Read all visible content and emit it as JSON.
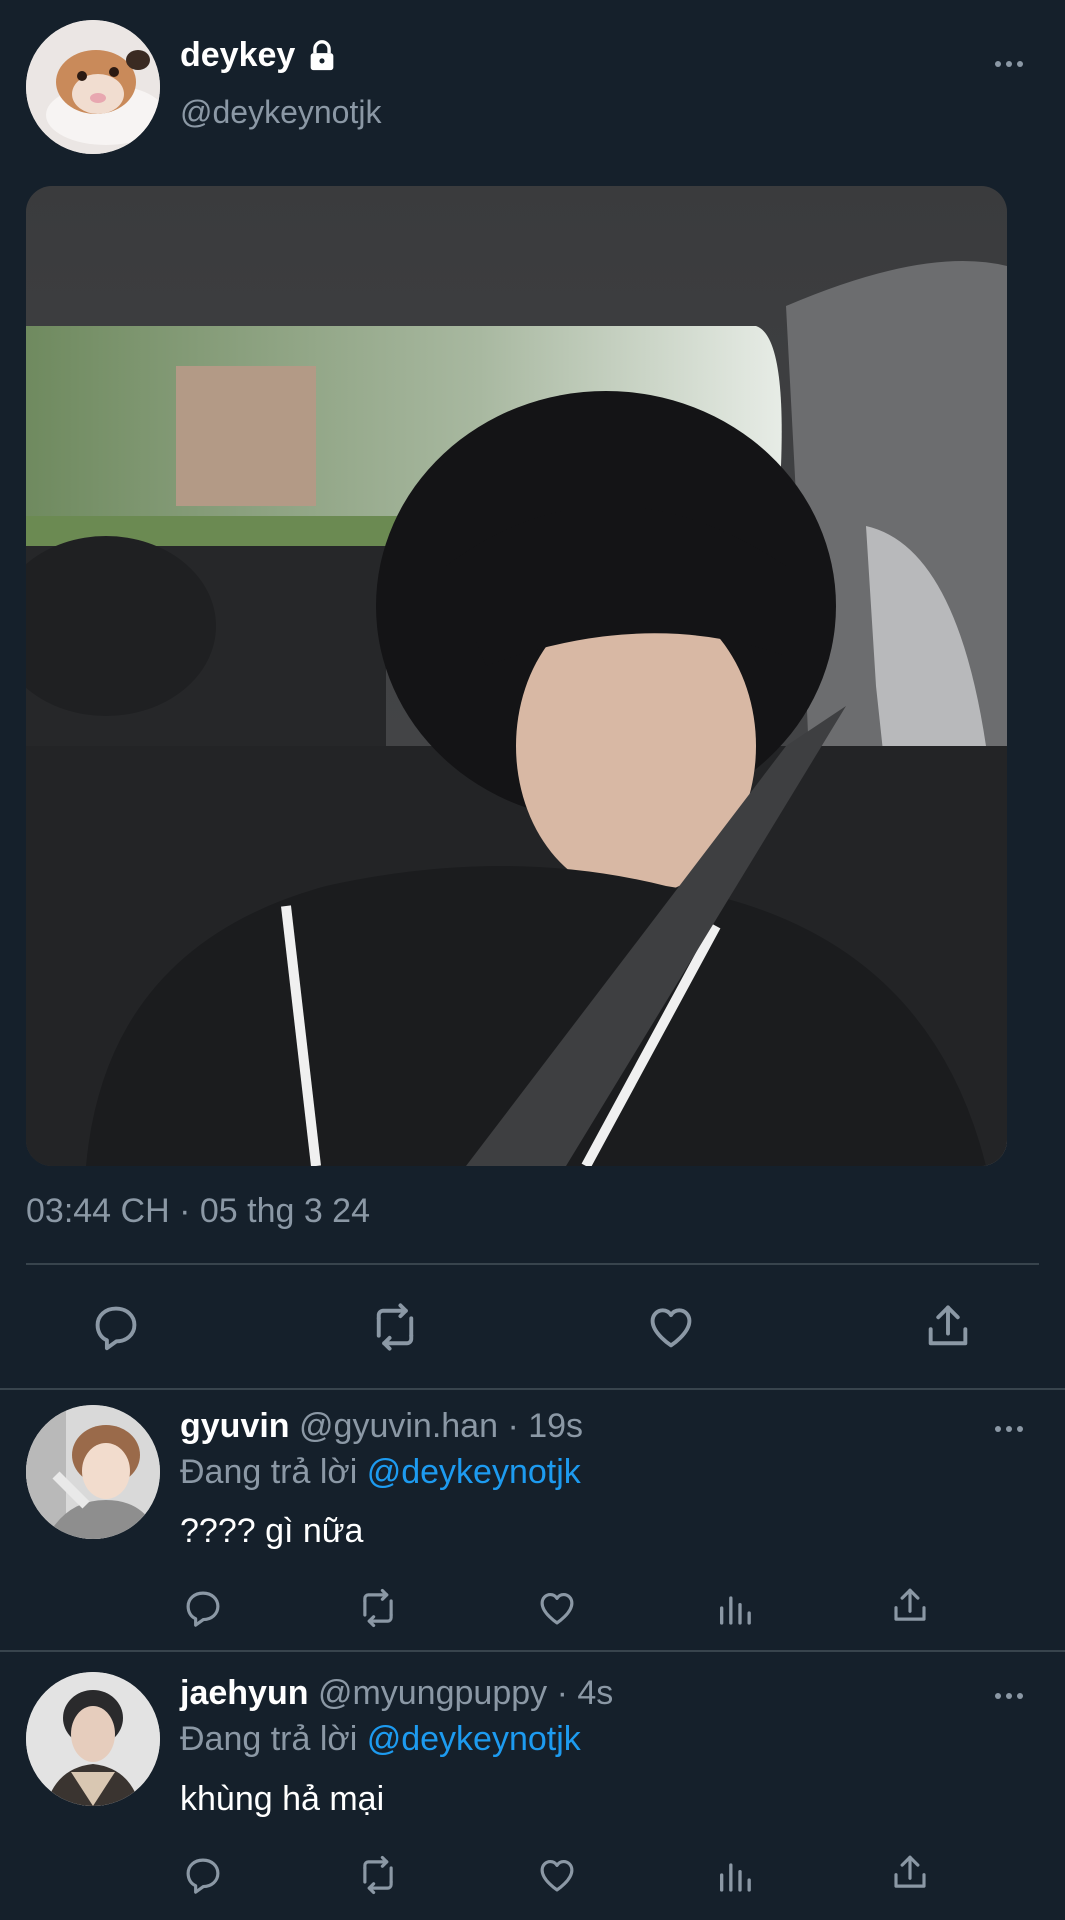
{
  "tweet": {
    "author_name": "deykey",
    "author_handle": "@deykeynotjk",
    "timestamp": "03:44 CH · 05 thg 3 24",
    "avatar_icon": "hamster-avatar",
    "media_icon": "photo-person-in-car",
    "locked_icon": "lock-icon"
  },
  "replies": [
    {
      "name": "gyuvin",
      "handle": "@gyuvin.han",
      "time": "· 19s",
      "replying_label": "Đang trả lời",
      "replying_to": "@deykeynotjk",
      "text": "???? gì nữa"
    },
    {
      "name": "jaehyun",
      "handle": "@myungpuppy",
      "time": "· 4s",
      "replying_label": "Đang trả lời",
      "replying_to": "@deykeynotjk",
      "text": "khùng hả mại"
    }
  ],
  "colors": {
    "background": "#15202b",
    "muted": "#8b98a5",
    "link": "#1d9bf0",
    "divider": "#38444d"
  }
}
